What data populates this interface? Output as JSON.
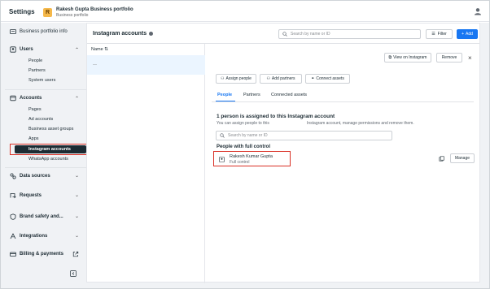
{
  "header": {
    "title": "Settings",
    "portfolio_initial": "R",
    "portfolio_name": "Rakesh Gupta Business portfolio",
    "portfolio_sub": "Business portfolio"
  },
  "sidebar": {
    "business_portfolio_info": "Business portfolio info",
    "users": "Users",
    "users_items": [
      "People",
      "Partners",
      "System users"
    ],
    "accounts": "Accounts",
    "accounts_items": [
      "Pages",
      "Ad accounts",
      "Business asset groups",
      "Apps",
      "Instagram accounts",
      "WhatsApp accounts"
    ],
    "data_sources": "Data sources",
    "requests": "Requests",
    "brand_safety": "Brand safety and...",
    "integrations": "Integrations",
    "billing": "Billing & payments"
  },
  "panel": {
    "title": "Instagram accounts",
    "search_placeholder": "Search by name or ID",
    "filter_label": "Filter",
    "add_label": "Add",
    "list_header": "Name ⇅",
    "list_item": "—"
  },
  "detail": {
    "view_on_instagram": "View on Instagram",
    "remove": "Remove",
    "close": "×",
    "assign_people": "Assign people",
    "add_partners": "Add partners",
    "connect_assets": "Connect assets",
    "tabs": [
      "People",
      "Partners",
      "Connected assets"
    ],
    "assigned_heading": "1 person is assigned to this Instagram account",
    "assigned_sub_left": "You can assign people to this",
    "assigned_sub_right": "Instagram account, manage permissions and remove them.",
    "people_search_placeholder": "Search by name or ID",
    "full_control_heading": "People with full control",
    "member_name": "Rakesh Kumar Gupta",
    "member_role": "Full control",
    "manage_label": "Manage"
  }
}
